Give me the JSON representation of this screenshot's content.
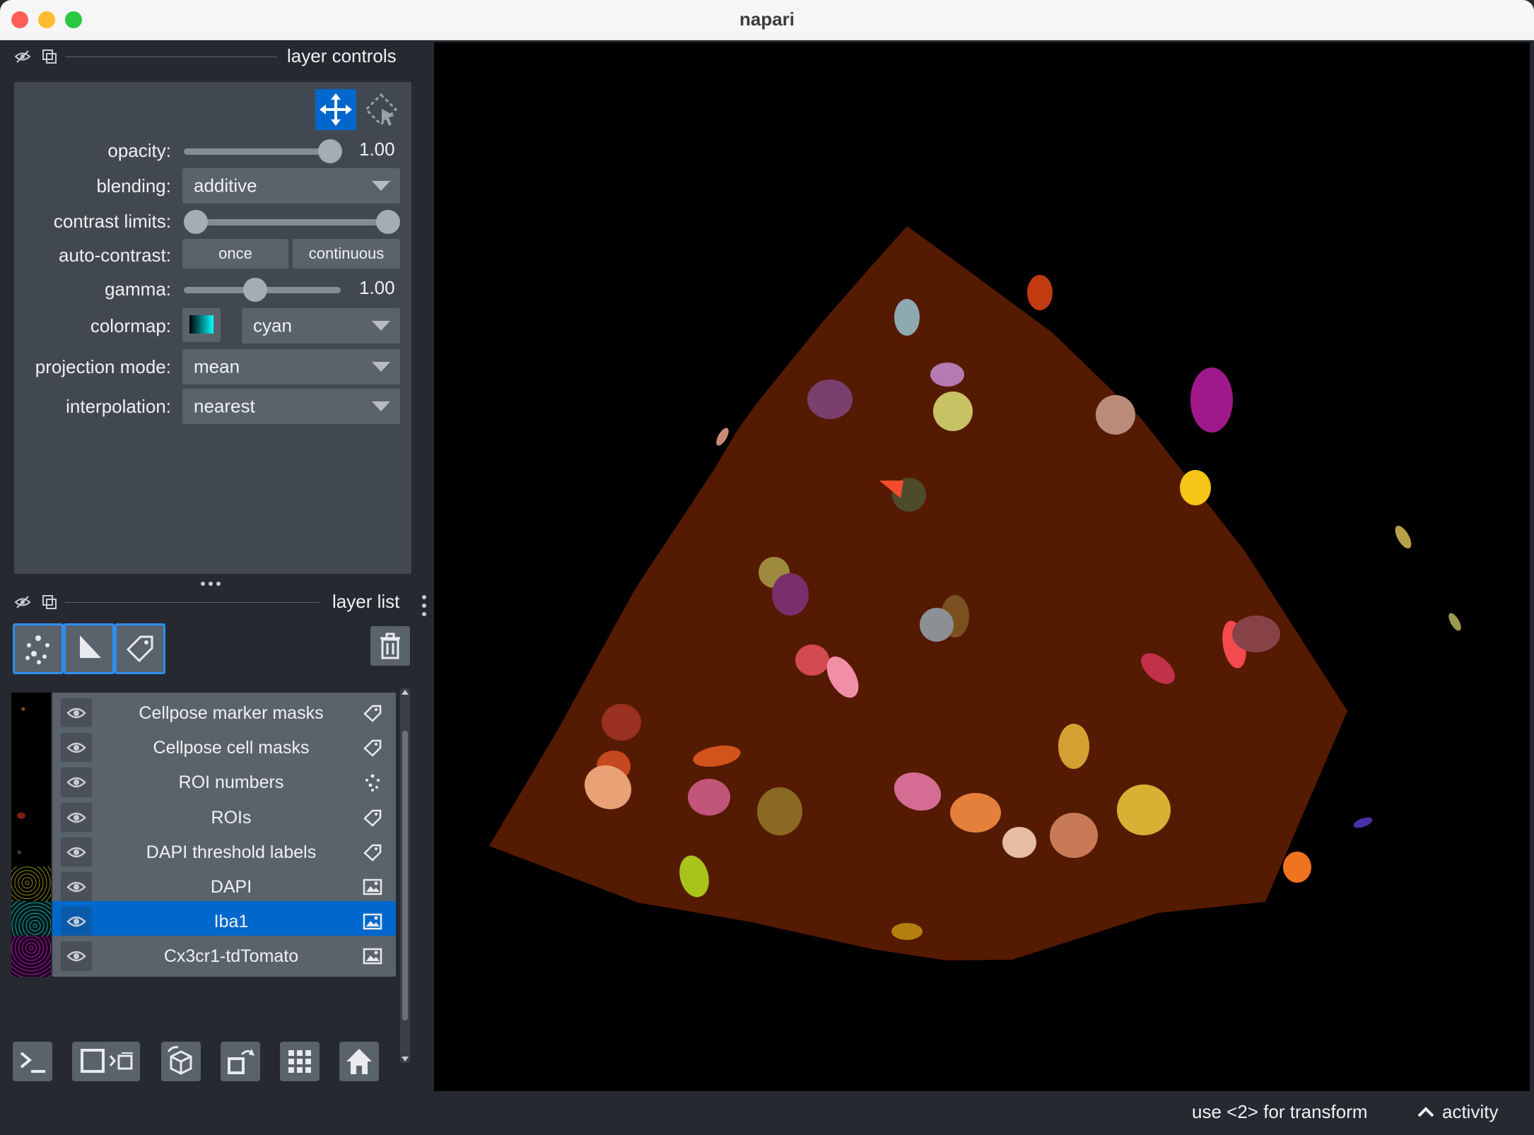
{
  "window": {
    "title": "napari"
  },
  "layer_controls": {
    "header": "layer controls",
    "opacity": {
      "label": "opacity:",
      "value": "1.00",
      "level": 1.0
    },
    "blending": {
      "label": "blending:",
      "value": "additive"
    },
    "contrast_limits": {
      "label": "contrast limits:"
    },
    "auto_contrast": {
      "label": "auto-contrast:",
      "once": "once",
      "continuous": "continuous"
    },
    "gamma": {
      "label": "gamma:",
      "value": "1.00"
    },
    "colormap": {
      "label": "colormap:",
      "value": "cyan"
    },
    "projection_mode": {
      "label": "projection mode:",
      "value": "mean"
    },
    "interpolation": {
      "label": "interpolation:",
      "value": "nearest"
    }
  },
  "layer_list": {
    "header": "layer list",
    "layers": [
      {
        "name": "Cellpose marker masks",
        "type": "labels-icon",
        "selected": false
      },
      {
        "name": "Cellpose cell masks",
        "type": "labels-icon",
        "selected": false
      },
      {
        "name": "ROI numbers",
        "type": "points-icon",
        "selected": false
      },
      {
        "name": "ROIs",
        "type": "labels-icon",
        "selected": false
      },
      {
        "name": "DAPI threshold labels",
        "type": "labels-icon",
        "selected": false
      },
      {
        "name": "DAPI",
        "type": "image-icon",
        "selected": false
      },
      {
        "name": "Iba1",
        "type": "image-icon",
        "selected": true
      },
      {
        "name": "Cx3cr1-tdTomato",
        "type": "image-icon",
        "selected": false
      }
    ]
  },
  "status": {
    "hint": "use <2> for transform",
    "activity": "activity"
  },
  "colors": {
    "accent": "#0068cc",
    "background": "#262930",
    "panel": "#414851",
    "volume": "#541a02"
  }
}
